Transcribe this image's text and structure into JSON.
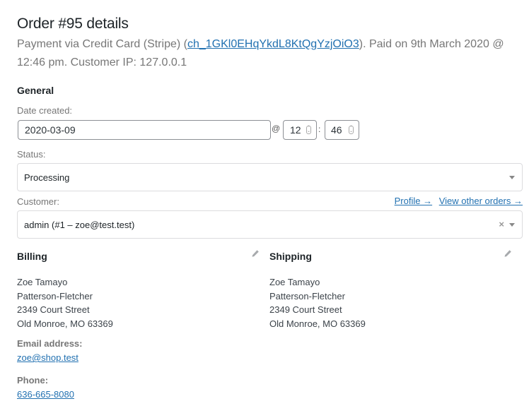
{
  "header": {
    "title": "Order #95 details",
    "payment_prefix": "Payment via Credit Card (Stripe) (",
    "transaction_id": "ch_1GKl0EHqYkdL8KtQgYzjOiO3",
    "payment_suffix": "). Paid on 9th March 2020 @ 12:46 pm. Customer IP: 127.0.0.1"
  },
  "general": {
    "heading": "General",
    "date_created_label": "Date created:",
    "date_value": "2020-03-09",
    "at_sign": "@",
    "hour_value": "12",
    "colon": ":",
    "minute_value": "46",
    "status_label": "Status:",
    "status_value": "Processing",
    "customer_label": "Customer:",
    "profile_link": "Profile →",
    "other_orders_link": "View other orders →",
    "customer_value": "admin (#1 – zoe@test.test)",
    "clear_glyph": "×"
  },
  "billing": {
    "heading": "Billing",
    "address_lines": [
      "Zoe Tamayo",
      "Patterson-Fletcher",
      "2349 Court Street",
      "Old Monroe, MO 63369"
    ],
    "email_label": "Email address:",
    "email": "zoe@shop.test",
    "phone_label": "Phone:",
    "phone": "636-665-8080"
  },
  "shipping": {
    "heading": "Shipping",
    "address_lines": [
      "Zoe Tamayo",
      "Patterson-Fletcher",
      "2349 Court Street",
      "Old Monroe, MO 63369"
    ]
  },
  "icons": {
    "edit": "pencil-icon",
    "dropdown": "triangle-down-icon",
    "spinner": "spinner-arrows-icon"
  },
  "colors": {
    "link": "#2271b1",
    "muted_text": "#777777",
    "heading_text": "#1d2327"
  }
}
